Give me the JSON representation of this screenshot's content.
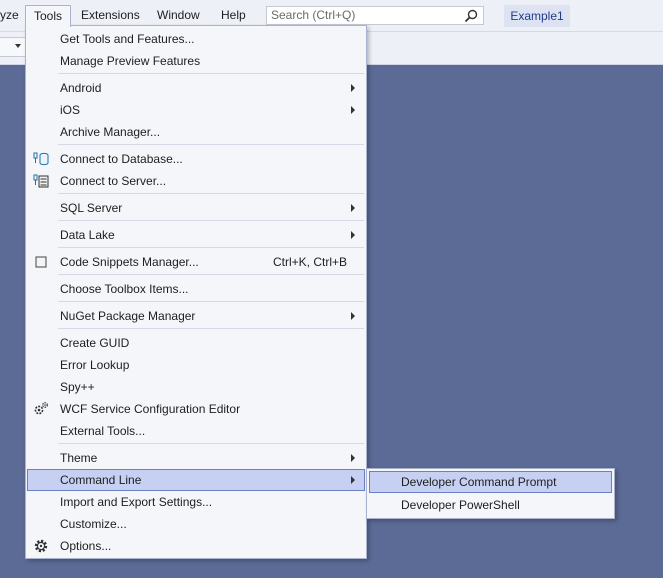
{
  "menubar": {
    "items": [
      "yze",
      "Tools",
      "Extensions",
      "Window",
      "Help"
    ],
    "search_placeholder": "Search (Ctrl+Q)",
    "solution_name": "Example1"
  },
  "tools_menu": {
    "items": [
      {
        "label": "Get Tools and Features...",
        "submenu": false
      },
      {
        "label": "Manage Preview Features",
        "submenu": false
      },
      {
        "label": "Android",
        "submenu": true
      },
      {
        "label": "iOS",
        "submenu": true
      },
      {
        "label": "Archive Manager...",
        "submenu": false
      },
      {
        "label": "Connect to Database...",
        "icon": "database-connect-icon"
      },
      {
        "label": "Connect to Server...",
        "icon": "server-connect-icon"
      },
      {
        "label": "SQL Server",
        "submenu": true
      },
      {
        "label": "Data Lake",
        "submenu": true
      },
      {
        "label": "Code Snippets Manager...",
        "shortcut": "Ctrl+K, Ctrl+B",
        "icon": "snippet-icon"
      },
      {
        "label": "Choose Toolbox Items..."
      },
      {
        "label": "NuGet Package Manager",
        "submenu": true
      },
      {
        "label": "Create GUID"
      },
      {
        "label": "Error Lookup"
      },
      {
        "label": "Spy++"
      },
      {
        "label": "WCF Service Configuration Editor",
        "icon": "wcf-config-icon"
      },
      {
        "label": "External Tools..."
      },
      {
        "label": "Theme",
        "submenu": true
      },
      {
        "label": "Command Line",
        "submenu": true,
        "highlighted": true
      },
      {
        "label": "Import and Export Settings..."
      },
      {
        "label": "Customize..."
      },
      {
        "label": "Options...",
        "icon": "gear-icon"
      }
    ]
  },
  "command_line_submenu": {
    "items": [
      {
        "label": "Developer Command Prompt",
        "highlighted": true
      },
      {
        "label": "Developer PowerShell"
      }
    ]
  }
}
